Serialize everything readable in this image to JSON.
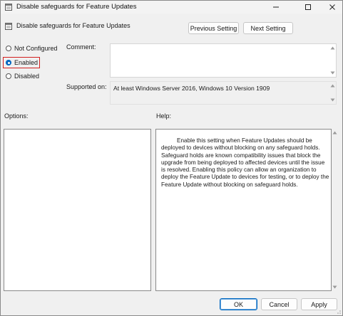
{
  "window": {
    "title": "Disable safeguards for Feature Updates"
  },
  "header": {
    "policy_title": "Disable safeguards for Feature Updates"
  },
  "nav": {
    "previous_label": "Previous Setting",
    "next_label": "Next Setting"
  },
  "state_options": [
    {
      "label": "Not Configured",
      "checked": false
    },
    {
      "label": "Enabled",
      "checked": true
    },
    {
      "label": "Disabled",
      "checked": false
    }
  ],
  "comment": {
    "label": "Comment:",
    "value": ""
  },
  "supported_on": {
    "label": "Supported on:",
    "value": "At least Windows Server 2016, Windows 10 Version 1909"
  },
  "options": {
    "label": "Options:"
  },
  "help": {
    "label": "Help:",
    "text": "Enable this setting when Feature Updates should be deployed to devices without blocking on any safeguard holds. Safeguard holds are known compatibility issues that block the upgrade from being deployed to affected devices until the issue is resolved. Enabling this policy can allow an organization to deploy the Feature Update to devices for testing, or to deploy the Feature Update without blocking on safeguard holds."
  },
  "footer": {
    "ok_label": "OK",
    "cancel_label": "Cancel",
    "apply_label": "Apply"
  },
  "colors": {
    "accent": "#0067c0",
    "highlight_box": "#d21f1f"
  }
}
